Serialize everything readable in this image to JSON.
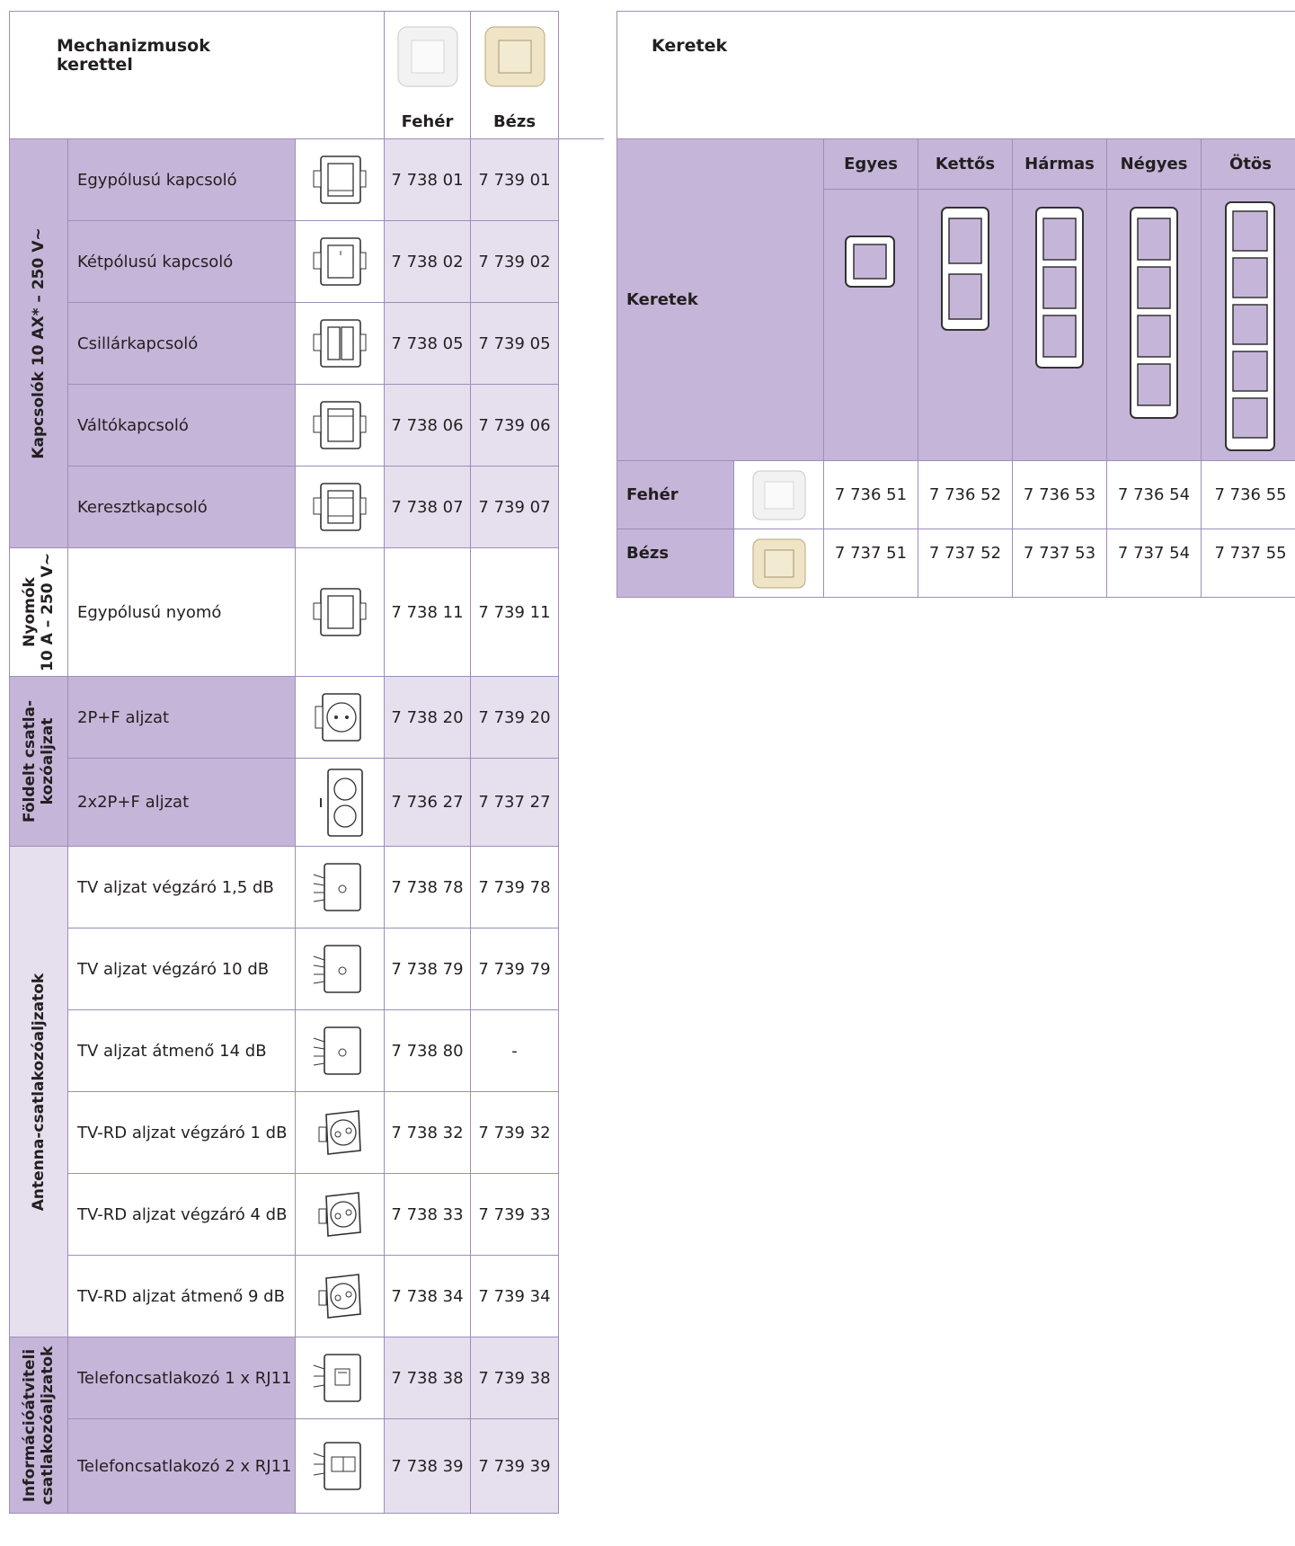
{
  "left_table": {
    "header": {
      "title_line1": "Mechanizmusok",
      "title_line2": "kerettel",
      "col_white": "Fehér",
      "col_beige": "Bézs"
    },
    "groups": [
      {
        "label": "Kapcsolók 10 AX* – 250 V~"
      },
      {
        "label_line1": "Nyomók",
        "label_line2": "10 A – 250 V~"
      },
      {
        "label_line1": "Földelt csatla-",
        "label_line2": "kozóaljzat"
      },
      {
        "label": "Antenna-csatlakozóaljzatok"
      },
      {
        "label_line1": "Információátviteli",
        "label_line2": "csatlakozóaljzatok"
      }
    ],
    "rows": [
      {
        "name": "Egypólusú kapcsoló",
        "white": "7 738 01",
        "beige": "7 739 01",
        "icon": "single-switch-icon"
      },
      {
        "name": "Kétpólusú kapcsoló",
        "white": "7 738 02",
        "beige": "7 739 02",
        "icon": "double-pole-switch-icon"
      },
      {
        "name": "Csillárkapcsoló",
        "white": "7 738 05",
        "beige": "7 739 05",
        "icon": "chandelier-switch-icon"
      },
      {
        "name": "Váltókapcsoló",
        "white": "7 738 06",
        "beige": "7 739 06",
        "icon": "two-way-switch-icon"
      },
      {
        "name": "Keresztkapcsoló",
        "white": "7 738 07",
        "beige": "7 739 07",
        "icon": "cross-switch-icon"
      },
      {
        "name": "Egypólusú nyomó",
        "white": "7 738 11",
        "beige": "7 739 11",
        "icon": "push-button-icon"
      },
      {
        "name": "2P+F aljzat",
        "white": "7 738 20",
        "beige": "7 739 20",
        "icon": "socket-icon"
      },
      {
        "name": "2x2P+F aljzat",
        "white": "7 736 27",
        "beige": "7 737 27",
        "icon": "double-socket-icon"
      },
      {
        "name": "TV aljzat végzáró 1,5 dB",
        "white": "7 738 78",
        "beige": "7 739 78",
        "icon": "tv-socket-icon"
      },
      {
        "name": "TV aljzat végzáró 10 dB",
        "white": "7 738 79",
        "beige": "7 739 79",
        "icon": "tv-socket-icon"
      },
      {
        "name": "TV aljzat átmenő 14 dB",
        "white": "7 738 80",
        "beige": "-",
        "icon": "tv-socket-icon"
      },
      {
        "name": "TV-RD aljzat végzáró 1 dB",
        "white": "7 738 32",
        "beige": "7 739 32",
        "icon": "tv-rd-socket-icon"
      },
      {
        "name": "TV-RD aljzat végzáró 4 dB",
        "white": "7 738 33",
        "beige": "7 739 33",
        "icon": "tv-rd-socket-icon"
      },
      {
        "name": "TV-RD aljzat átmenő 9 dB",
        "white": "7 738 34",
        "beige": "7 739 34",
        "icon": "tv-rd-socket-icon"
      },
      {
        "name": "Telefoncsatlakozó 1 x RJ11",
        "white": "7 738 38",
        "beige": "7 739 38",
        "icon": "rj11-socket-icon"
      },
      {
        "name": "Telefoncsatlakozó 2 x RJ11",
        "white": "7 738 39",
        "beige": "7 739 39",
        "icon": "double-rj11-socket-icon"
      }
    ]
  },
  "right_table": {
    "title": "Keretek",
    "row_header": "Keretek",
    "columns": [
      "Egyes",
      "Kettős",
      "Hármas",
      "Négyes",
      "Ötös"
    ],
    "rows": [
      {
        "label": "Fehér",
        "codes": [
          "7 736 51",
          "7 736 52",
          "7 736 53",
          "7 736 54",
          "7 736 55"
        ]
      },
      {
        "label": "Bézs",
        "codes": [
          "7 737 51",
          "7 737 52",
          "7 737 53",
          "7 737 54",
          "7 737 55"
        ]
      }
    ]
  },
  "colors": {
    "purple": "#c5b6d9",
    "light_purple": "#e6dfee",
    "border": "#9e8db8",
    "white_swatch": "#f2f2f2",
    "beige_swatch": "#efe4c6"
  }
}
